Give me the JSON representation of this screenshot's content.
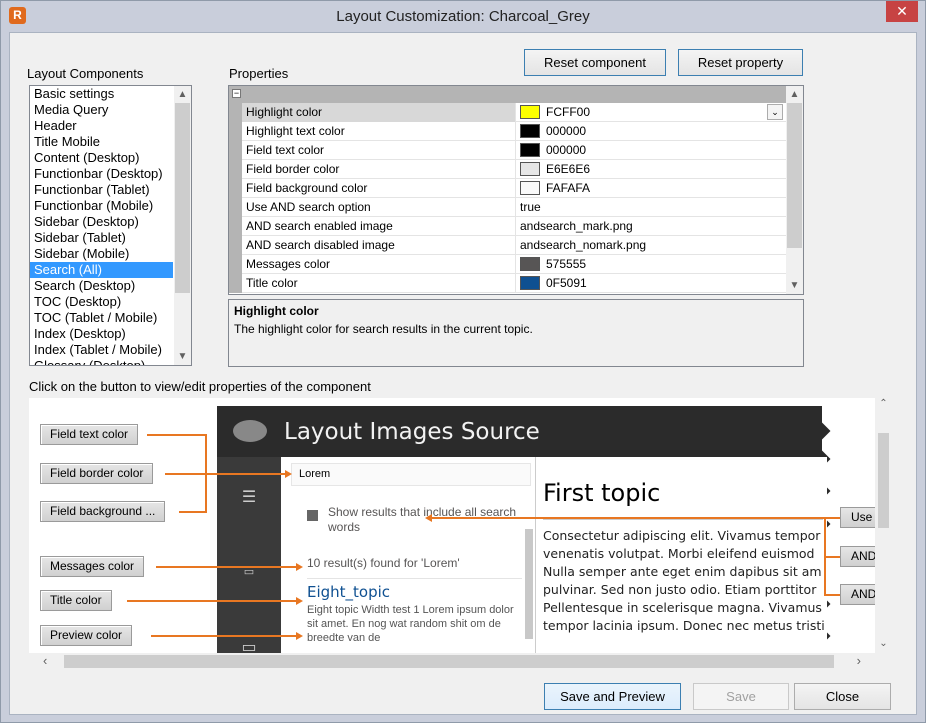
{
  "window": {
    "title": "Layout Customization: Charcoal_Grey",
    "app_icon": "R",
    "close": "✕"
  },
  "labels": {
    "components": "Layout Components",
    "properties": "Properties",
    "instruction": "Click on the button to view/edit properties of the component"
  },
  "buttons": {
    "reset_component": "Reset component",
    "reset_property": "Reset property",
    "save_and_preview": "Save and Preview",
    "save": "Save",
    "close": "Close"
  },
  "components": [
    "Basic settings",
    "Media Query",
    "Header",
    "Title Mobile",
    "Content (Desktop)",
    "Functionbar (Desktop)",
    "Functionbar (Tablet)",
    "Functionbar (Mobile)",
    "Sidebar (Desktop)",
    "Sidebar (Tablet)",
    "Sidebar (Mobile)",
    "Search (All)",
    "Search (Desktop)",
    "TOC (Desktop)",
    "TOC (Tablet / Mobile)",
    "Index (Desktop)",
    "Index (Tablet / Mobile)",
    "Glossary (Desktop)"
  ],
  "selected_component": "Search (All)",
  "properties": [
    {
      "name": "Highlight color",
      "value": "FCFF00",
      "swatch": "#FCFF00"
    },
    {
      "name": "Highlight text color",
      "value": "000000",
      "swatch": "#000000"
    },
    {
      "name": "Field text color",
      "value": "000000",
      "swatch": "#000000"
    },
    {
      "name": "Field border color",
      "value": "E6E6E6",
      "swatch": "#E6E6E6"
    },
    {
      "name": "Field background color",
      "value": "FAFAFA",
      "swatch": "#FAFAFA"
    },
    {
      "name": "Use AND search option",
      "value": "true"
    },
    {
      "name": "AND search enabled image",
      "value": "andsearch_mark.png"
    },
    {
      "name": "AND search disabled image",
      "value": "andsearch_nomark.png"
    },
    {
      "name": "Messages color",
      "value": "575555",
      "swatch": "#575555"
    },
    {
      "name": "Title color",
      "value": "0F5091",
      "swatch": "#0F5091"
    }
  ],
  "description": {
    "title": "Highlight color",
    "text": "The highlight color for search results in the current topic."
  },
  "preview": {
    "left_buttons": [
      "Field text color",
      "Field border color",
      "Field background ...",
      "Messages color",
      "Title color",
      "Preview color"
    ],
    "right_buttons": [
      "Use",
      "AND",
      "AND"
    ],
    "header_title": "Layout Images Source",
    "search_value": "Lorem",
    "checkbox_label": "Show results that include all search words",
    "results_message": "10 result(s) found for 'Lorem'",
    "result_title": "Eight_topic",
    "result_desc": "Eight topic Width test 1 Lorem ipsum dolor sit amet. En nog wat random shit om de breedte van de",
    "content_title": "First topic",
    "content_body": "Consectetur adipiscing elit. Vivamus tempor venenatis volutpat. Morbi eleifend euismod Nulla semper ante eget enim dapibus sit am pulvinar. Sed non justo odio. Etiam porttitor Pellentesque in scelerisque magna. Vivamus tempor lacinia ipsum. Donec nec metus tristi"
  }
}
